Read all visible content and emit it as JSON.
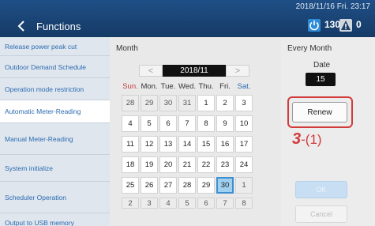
{
  "header": {
    "title": "Functions",
    "datetime": "2018/11/16 Fri. 23:17",
    "power_count": "130",
    "alert_count": "0"
  },
  "sidebar": {
    "items": [
      {
        "label": "Release power peak cut"
      },
      {
        "label": "Outdoor Demand Schedule"
      },
      {
        "label": "Operation mode restriction"
      },
      {
        "label": "Automatic Meter-Reading",
        "active": true
      },
      {
        "label": "Manual Meter-Reading"
      },
      {
        "label": "System initialize"
      },
      {
        "label": "Scheduler Operation"
      },
      {
        "label": "Output to USB memory"
      }
    ]
  },
  "calendar": {
    "label": "Month",
    "month": "2018/11",
    "prev": "<",
    "next": ">",
    "weekdays": [
      "Sun.",
      "Mon.",
      "Tue.",
      "Wed.",
      "Thu.",
      "Fri.",
      "Sat."
    ],
    "days": [
      [
        "28",
        "29",
        "30",
        "31",
        "1",
        "2",
        "3"
      ],
      [
        "4",
        "5",
        "6",
        "7",
        "8",
        "9",
        "10"
      ],
      [
        "11",
        "12",
        "13",
        "14",
        "15",
        "16",
        "17"
      ],
      [
        "18",
        "19",
        "20",
        "21",
        "22",
        "23",
        "24"
      ],
      [
        "25",
        "26",
        "27",
        "28",
        "29",
        "30",
        "1"
      ],
      [
        "2",
        "3",
        "4",
        "5",
        "6",
        "7",
        "8"
      ]
    ]
  },
  "right_panel": {
    "every_month": "Every Month",
    "date_label": "Date",
    "date_value": "15",
    "renew_label": "Renew",
    "callout_step": "3",
    "callout_sub": "-(1)",
    "ok_label": "OK",
    "cancel_label": "Cancel"
  }
}
